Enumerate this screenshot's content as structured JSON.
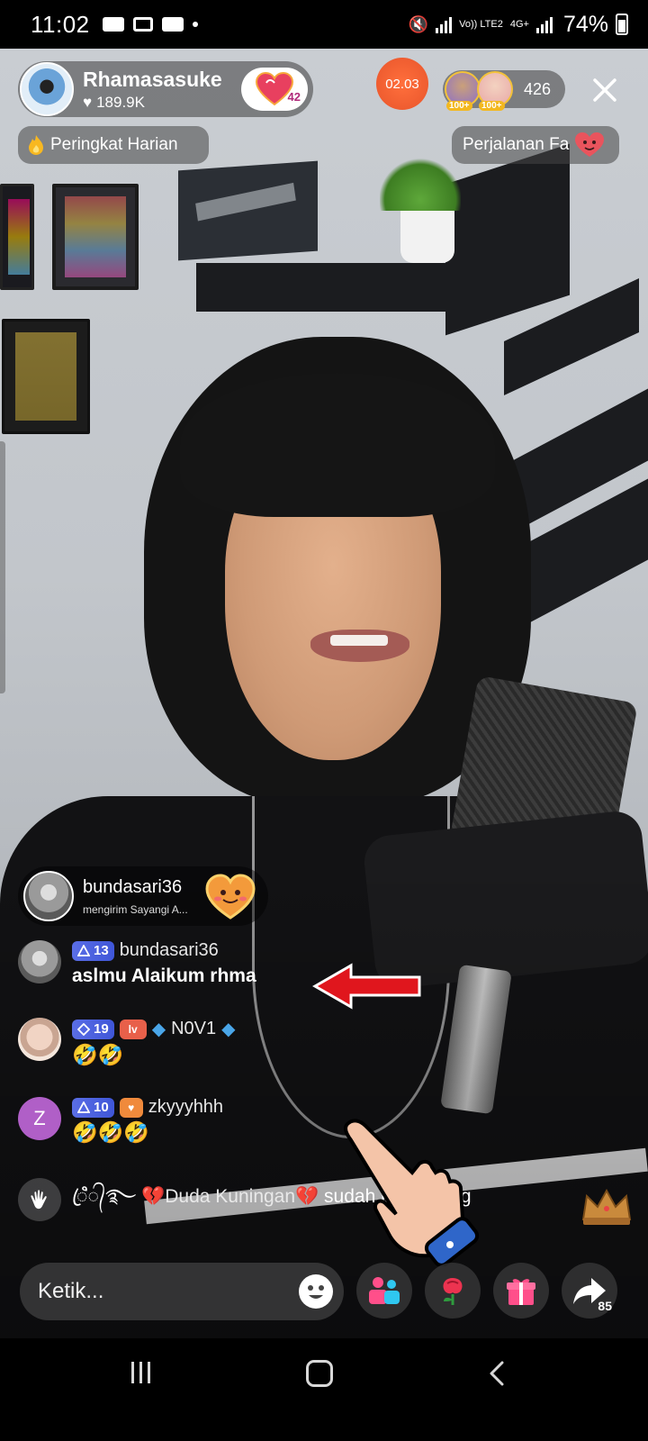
{
  "status_bar": {
    "time": "11:02",
    "network": "Vo)) LTE2",
    "network_gen": "4G+",
    "battery": "74%"
  },
  "host": {
    "name": "Rhamasasuke",
    "likes": "189.9K",
    "fan_level": "42",
    "avatar_icon": "host-avatar"
  },
  "timer": "02.03",
  "viewers": {
    "badge1": "100+",
    "badge2": "100+",
    "count": "426"
  },
  "ranking": {
    "label": "Peringkat Harian",
    "icon": "flame-icon"
  },
  "journey": {
    "label": "Perjalanan Fa",
    "icon": "heart-face-icon"
  },
  "gift_banner": {
    "user": "bundasari36",
    "text": "mengirim Sayangi A..."
  },
  "chat": [
    {
      "level": "13",
      "user": "bundasari36",
      "text": "aslmu Alaikum rhma",
      "avatar_color": "#8a8a8a"
    },
    {
      "level": "19",
      "badge": "lv",
      "user": "N0V1",
      "text": "🤣🤣",
      "avatar_color": "#e9c8b6"
    },
    {
      "level": "10",
      "badge": "",
      "user": "zkyyyhhh",
      "text": "🤣🤣🤣",
      "avatar_letter": "Z",
      "avatar_color": "#b05fc7"
    }
  ],
  "join": {
    "prefix": "ꦿꦶ᭄࿐",
    "user": "💔Duda Kuningan💔",
    "suffix": "sudah bergabung"
  },
  "input": {
    "placeholder": "Ketik..."
  },
  "share_count": "85",
  "colors": {
    "accent_orange": "#e8552b",
    "level_blue": "#3f56d8",
    "gold": "#f3b81f"
  }
}
